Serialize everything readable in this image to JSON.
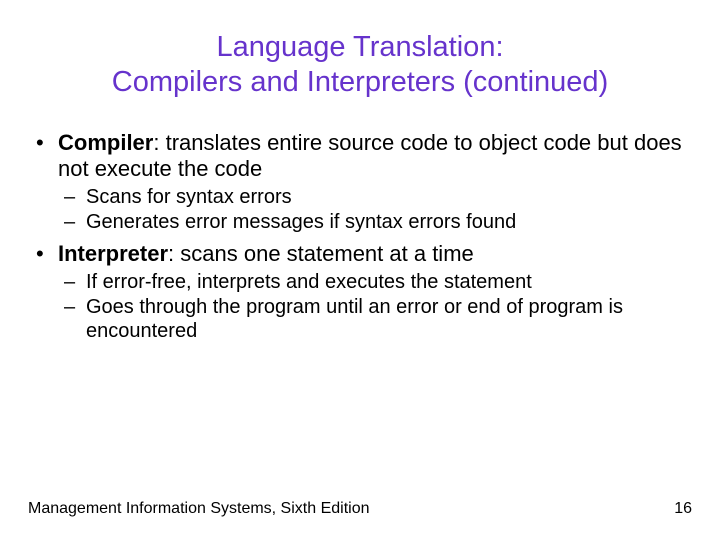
{
  "title_line1": "Language Translation:",
  "title_line2": "Compilers and Interpreters (continued)",
  "bullets": [
    {
      "term": "Compiler",
      "rest": ": translates entire source code to object code but does not execute the code",
      "subs": [
        "Scans for syntax errors",
        "Generates error messages if syntax errors found"
      ]
    },
    {
      "term": "Interpreter",
      "rest": ": scans one statement at a time",
      "subs": [
        "If error-free, interprets and executes the statement",
        "Goes through the program until an error or end of program is encountered"
      ]
    }
  ],
  "footer_left": "Management Information Systems, Sixth Edition",
  "footer_right": "16"
}
